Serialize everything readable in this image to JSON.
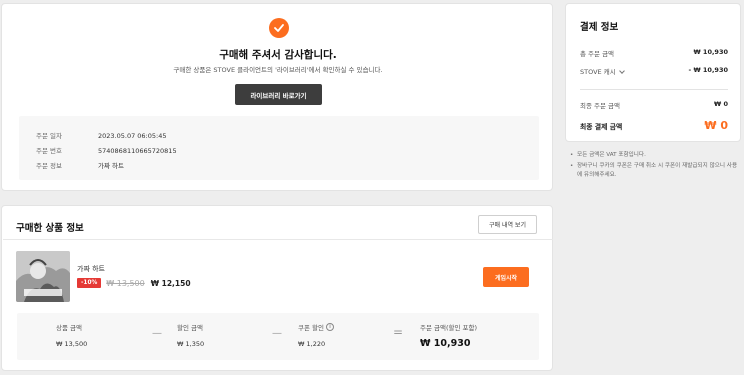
{
  "confirmation": {
    "title": "구매해 주셔서 감사합니다.",
    "subtitle": "구매한 상품은 STOVE 클라이언트의 '라이브러리'에서 확인하실 수 있습니다.",
    "library_button": "라이브러리 바로가기",
    "order": {
      "date_label": "주문 일자",
      "date_value": "2023.05.07 06:05:45",
      "number_label": "주문 번호",
      "number_value": "5740868110665720815",
      "product_label": "주문 정보",
      "product_value": "가짜 하트"
    }
  },
  "payment": {
    "title": "결제 정보",
    "total_label": "총 주문 금액",
    "total_value": "₩ 10,930",
    "cash_label": "STOVE 캐시",
    "cash_value": "- ₩ 10,930",
    "final_order_label": "최종 주문 금액",
    "final_order_value": "₩ 0",
    "final_pay_label": "최종 결제 금액",
    "final_pay_value": "₩ 0"
  },
  "notes": [
    "모든 금액은 VAT 포함입니다.",
    "장바구니 쿠카의 쿠폰은 구매 취소 시 쿠폰이 재발급되지 않으니 사용에 유의해주세요."
  ],
  "products": {
    "title": "구매한 상품 정보",
    "history_button": "구매 내역 보기",
    "item": {
      "name": "가짜 하트",
      "discount": "-10%",
      "original_price": "₩ 13,500",
      "sale_price": "₩ 12,150",
      "start_button": "게임시작"
    },
    "summary": {
      "product_amount_label": "상품 금액",
      "product_amount_value": "₩ 13,500",
      "discount_label": "할인 금액",
      "discount_value": "₩ 1,350",
      "coupon_label": "쿠폰 할인",
      "coupon_value": "₩ 1,220",
      "total_label": "주문 금액(할인 포함)",
      "total_value": "₩ 10,930"
    }
  },
  "colors": {
    "accent": "#fc6d1f",
    "discount": "#e53935",
    "dark_button": "#3d3d3d"
  }
}
